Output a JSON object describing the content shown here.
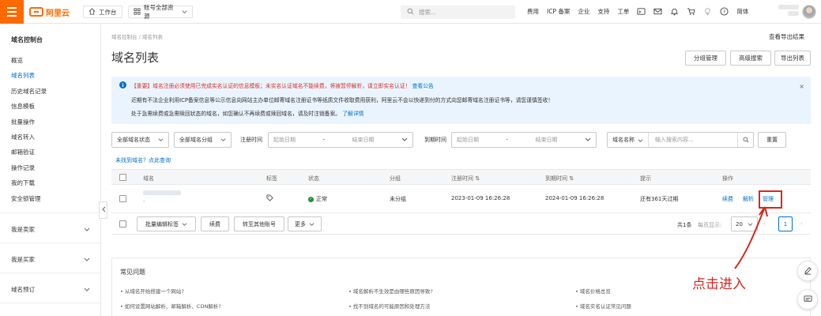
{
  "topbar": {
    "logo_text": "阿里云",
    "workbench": "工作台",
    "account_scope": "账号全部资源",
    "search_placeholder": "搜索...",
    "links": [
      "费用",
      "ICP 备案",
      "企业",
      "支持",
      "工单"
    ],
    "lang": "简体",
    "icons": [
      "terminal-icon",
      "mail-icon",
      "bell-icon",
      "cart-icon",
      "bulb-icon",
      "help-icon"
    ]
  },
  "sidebar": {
    "title": "域名控制台",
    "items": [
      {
        "label": "概览",
        "active": false
      },
      {
        "label": "域名列表",
        "active": true
      },
      {
        "label": "历史域名记录",
        "active": false
      },
      {
        "label": "信息模板",
        "active": false
      },
      {
        "label": "批量操作",
        "active": false
      },
      {
        "label": "域名转入",
        "active": false
      },
      {
        "label": "邮箱验证",
        "active": false
      },
      {
        "label": "操作记录",
        "active": false
      },
      {
        "label": "我的下载",
        "active": false
      },
      {
        "label": "安全锁管理",
        "active": false
      }
    ],
    "groups": [
      "我是卖家",
      "我是买家",
      "域名预订"
    ]
  },
  "main": {
    "breadcrumb": [
      "域名控制台",
      "域名列表"
    ],
    "export_results": "查看导出结果",
    "title": "域名列表",
    "buttons": {
      "group_manage": "分组管理",
      "advanced_search": "高级搜索",
      "export_list": "导出列表"
    },
    "notice": {
      "line1_red": "【重要】域名注册必须使用已完成实名认证的信息模板；未实名认证域名不能续费，将被暂停解析，请立即实名认证！",
      "line1_link": "查看公告",
      "line2": "近期有不法企业利用ICP备案信息等公示信息向网站主办单位邮寄域名注册证书等纸质文件收取费用获利，阿里云不会以快递到付的方式向您邮寄域名注册证书等，请您谨慎签收！",
      "line3": "处于急需续费或急需赎回状态的域名，如您确认不再续费或赎回域名，请及时注销备案。",
      "line3_link": "了解详情"
    },
    "filters": {
      "status": "全部域名状态",
      "group": "全部域名分组",
      "reg_label": "注册时间",
      "reg_start": "起始日期",
      "reg_end": "结束日期",
      "exp_label": "到期时间",
      "exp_start": "起始日期",
      "exp_end": "结束日期",
      "name_select": "域名名称",
      "keyword_placeholder": "输入搜索内容...",
      "reset": "重置"
    },
    "not_found_link": "未找到域名？点此查询",
    "table": {
      "headers": [
        "域名",
        "标签",
        "状态",
        "分组",
        "注册时间",
        "到期时间",
        "提示",
        "操作"
      ],
      "rows": [
        {
          "domain_sub": "-",
          "status": "正常",
          "group": "未分组",
          "registered": "2023-01-09 16:26:28",
          "expires": "2024-01-09 16:26:28",
          "hint": "还有361天过期",
          "actions": [
            "续费",
            "解析",
            "管理"
          ]
        }
      ]
    },
    "bulk": {
      "bulk_tag": "批量编辑标签",
      "renew": "续费",
      "transfer": "转至其他账号",
      "more": "更多",
      "total": "共1条",
      "per_page_label": "每页显示:",
      "per_page": "20",
      "current_page": "1"
    },
    "faq": {
      "title": "常见问题",
      "items": [
        "从域名开始搭建一个网站?",
        "域名解析不生效是由哪些原因导致?",
        "域名价格总览",
        "如何设置网站解析、邮箱解析、CDN解析?",
        "找不到域名的可能原因和处理方法",
        "域名实名认证常见问题"
      ]
    }
  },
  "annotation": {
    "text": "点击进入",
    "color": "#d9261c"
  },
  "colors": {
    "brand": "#ff6a00",
    "link": "#0070cc",
    "alert_red": "#d93026",
    "success": "#1e8e3e",
    "notice_bg": "#eaf4fe"
  }
}
